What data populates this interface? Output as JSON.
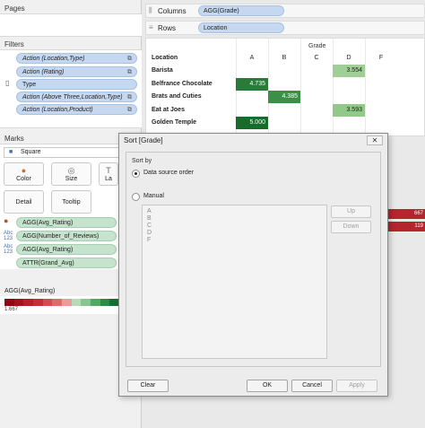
{
  "pages": {
    "title": "Pages"
  },
  "filters": {
    "title": "Filters",
    "items": [
      "Action (Location,Type)",
      "Action (Rating)",
      "Type",
      "Action (Above Three,Location,Type)",
      "Action (Location,Product)"
    ]
  },
  "marks": {
    "title": "Marks",
    "mark_type": "Square",
    "buttons": [
      "Color",
      "Size",
      "La",
      "Detail",
      "Tooltip"
    ],
    "fields": [
      "AGG(Avg_Rating)",
      "AGG(Number_of_Reviews)",
      "AGG(Avg_Rating)",
      "ATTR(Grand_Avg)"
    ],
    "field_icon_text": "Abc 123"
  },
  "legend": {
    "title": "AGG(Avg_Rating)",
    "min_label": "1.667",
    "colors": [
      "#8b0a14",
      "#a0121c",
      "#b51f27",
      "#c53036",
      "#d54a4d",
      "#e06a6a",
      "#ec9a9a",
      "#b8dcb8",
      "#88c58f",
      "#55a862",
      "#2f8a43",
      "#1a6d31"
    ]
  },
  "shelves": {
    "columns_label": "Columns",
    "columns_pill": "AGG(Grade)",
    "rows_label": "Rows",
    "rows_pill": "Location"
  },
  "viz": {
    "header_top": "Grade",
    "row_header": "Location",
    "columns": [
      "A",
      "B",
      "C",
      "D",
      "F"
    ],
    "rows": [
      {
        "name": "Barista",
        "cells": [
          {
            "col": 3,
            "value": "3.554",
            "color": "#9fcf96"
          }
        ]
      },
      {
        "name": "Belfrance Chocolate",
        "cells": [
          {
            "col": 0,
            "value": "4.735",
            "color": "#2a7a3a"
          }
        ]
      },
      {
        "name": "Brats and Cuties",
        "cells": [
          {
            "col": 1,
            "value": "4.385",
            "color": "#3b8f46"
          }
        ]
      },
      {
        "name": "Eat at Joes",
        "cells": [
          {
            "col": 3,
            "value": "3.593",
            "color": "#92c889"
          }
        ]
      },
      {
        "name": "Golden Temple",
        "cells": [
          {
            "col": 0,
            "value": "5.000",
            "color": "#196b2c"
          }
        ]
      }
    ],
    "edge_values": [
      "667",
      "119"
    ]
  },
  "dialog": {
    "title": "Sort [Grade]",
    "close": "✕",
    "group_label": "Sort by",
    "option_data_source": "Data source order",
    "option_manual": "Manual",
    "selected": "data_source",
    "list_items": [
      "A",
      "B",
      "C",
      "D",
      "F"
    ],
    "up": "Up",
    "down": "Down",
    "clear": "Clear",
    "ok": "OK",
    "cancel": "Cancel",
    "apply": "Apply"
  }
}
